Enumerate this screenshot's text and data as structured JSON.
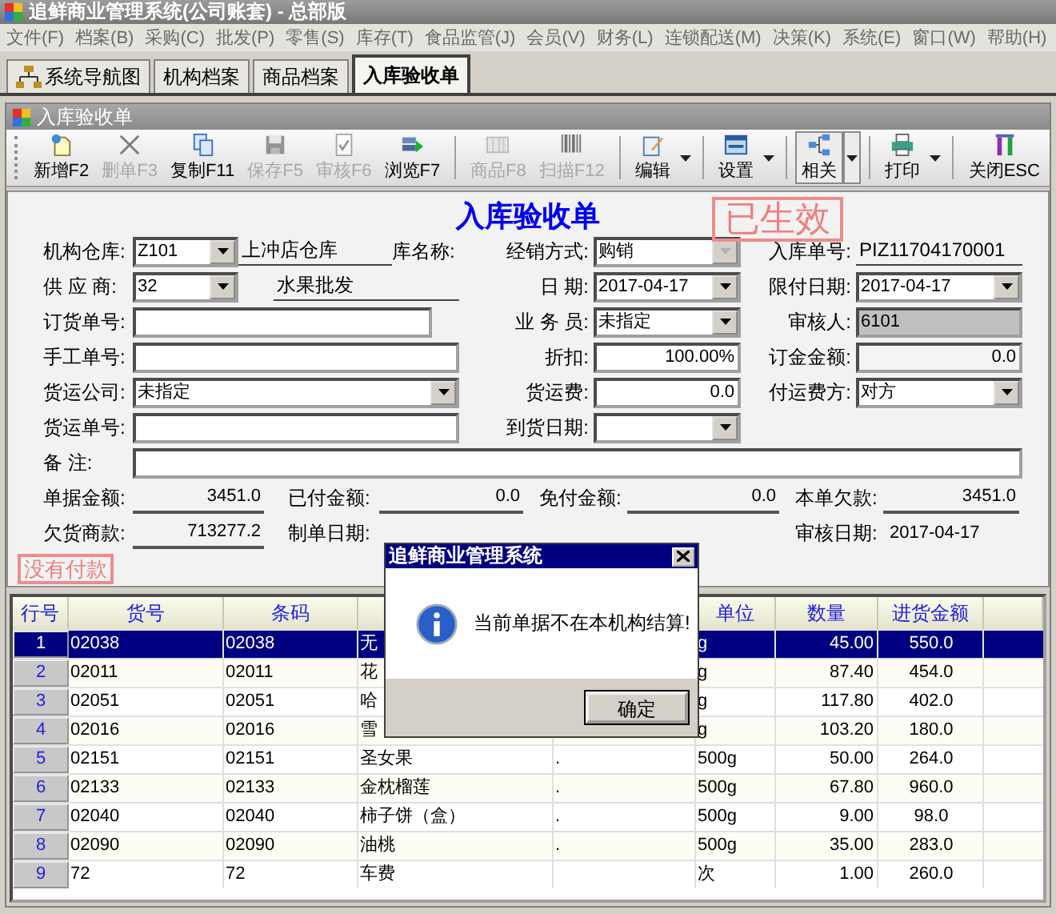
{
  "window": {
    "title": "追鲜商业管理系统(公司账套) - 总部版"
  },
  "menu": [
    "文件(F)",
    "档案(B)",
    "采购(C)",
    "批发(P)",
    "零售(S)",
    "库存(T)",
    "食品监管(J)",
    "会员(V)",
    "财务(L)",
    "连锁配送(M)",
    "决策(K)",
    "系统(E)",
    "窗口(W)",
    "帮助(H)"
  ],
  "tabs": [
    {
      "label": "系统导航图",
      "selected": false
    },
    {
      "label": "机构档案",
      "selected": false
    },
    {
      "label": "商品档案",
      "selected": false
    },
    {
      "label": "入库验收单",
      "selected": true
    }
  ],
  "document": {
    "title": "入库验收单",
    "toolbar": [
      {
        "label": "新增F2",
        "kind": "plain",
        "disabled": false,
        "pressed": false
      },
      {
        "label": "删单F3",
        "kind": "plain",
        "disabled": true,
        "pressed": false
      },
      {
        "label": "复制F11",
        "kind": "plain",
        "disabled": false,
        "pressed": false
      },
      {
        "label": "保存F5",
        "kind": "plain",
        "disabled": true,
        "pressed": false
      },
      {
        "label": "审核F6",
        "kind": "plain",
        "disabled": true,
        "pressed": false
      },
      {
        "label": "浏览F7",
        "kind": "plain",
        "disabled": false,
        "pressed": false
      },
      {
        "label": "商品F8",
        "kind": "plain",
        "disabled": true,
        "pressed": false
      },
      {
        "label": "扫描F12",
        "kind": "plain",
        "disabled": true,
        "pressed": false
      },
      {
        "label": "编辑",
        "kind": "dropdown",
        "disabled": false,
        "pressed": false
      },
      {
        "label": "设置",
        "kind": "dropdown",
        "disabled": false,
        "pressed": false
      },
      {
        "label": "相关",
        "kind": "dropdown",
        "disabled": false,
        "pressed": true
      },
      {
        "label": "打印",
        "kind": "dropdown",
        "disabled": false,
        "pressed": false
      },
      {
        "label": "关闭ESC",
        "kind": "plain",
        "disabled": false,
        "pressed": false
      }
    ],
    "form": {
      "title": "入库验收单",
      "fields": [
        {
          "label": "机构仓库:",
          "kind": "combo",
          "value": "Z101",
          "disabled": false,
          "name": "上冲店仓库"
        },
        {
          "label": "库名称:",
          "kind": "label"
        },
        {
          "label": "经销方式:",
          "kind": "combo",
          "value": "购销",
          "disabled": true
        },
        {
          "label": "入库单号:",
          "kind": "display",
          "value": "PIZ11704170001"
        },
        {
          "label": "供 应 商:",
          "kind": "combo",
          "value": "32",
          "disabled": false,
          "name": "水果批发"
        },
        {
          "label": "日    期:",
          "kind": "combo",
          "value": "2017-04-17",
          "disabled": false
        },
        {
          "label": "限付日期:",
          "kind": "combo",
          "value": "2017-04-17",
          "disabled": false
        },
        {
          "label": "订货单号:",
          "kind": "input"
        },
        {
          "label": "业 务 员:",
          "kind": "combo",
          "value": "未指定",
          "disabled": false
        },
        {
          "label": "审核人:",
          "kind": "readonly",
          "value": "6101"
        },
        {
          "label": "手工单号:",
          "kind": "input"
        },
        {
          "label": "折扣:",
          "kind": "number",
          "value": "100.00%"
        },
        {
          "label": "订金金额:",
          "kind": "static",
          "value": "0.0"
        },
        {
          "label": "货运公司:",
          "kind": "combo",
          "value": "未指定",
          "disabled": false
        },
        {
          "label": "货运费:",
          "kind": "number",
          "value": "0.0"
        },
        {
          "label": "付运费方:",
          "kind": "combo",
          "value": "对方",
          "disabled": false
        },
        {
          "label": "货运单号:",
          "kind": "input"
        },
        {
          "label": "到货日期:",
          "kind": "combo",
          "disabled": false
        },
        {
          "label": "备    注:",
          "kind": "input"
        }
      ],
      "totals": [
        {
          "label": "单据金额:",
          "kind": "amount",
          "value": "3451.0"
        },
        {
          "label": "已付金额:",
          "kind": "amount",
          "value": "0.0"
        },
        {
          "label": "免付金额:",
          "kind": "amount",
          "value": "0.0"
        },
        {
          "label": "本单欠款:",
          "kind": "amount",
          "value": "3451.0"
        },
        {
          "label": "欠货商款:",
          "kind": "amount",
          "value": "713277.2"
        },
        {
          "label": "制单日期:",
          "kind": "label"
        },
        {
          "label": "审核日期:",
          "kind": "plain",
          "value": "2017-04-17"
        }
      ]
    },
    "stamps": [
      {
        "kind": "status",
        "text": "已生效"
      },
      {
        "kind": "payment",
        "text": "没有付款"
      }
    ],
    "grid": {
      "columns": [
        "行号",
        "货号",
        "条码",
        null,
        null,
        "单位",
        "数量",
        "进货金额",
        null
      ],
      "rows": [
        {
          "no": "1",
          "selected": true,
          "cells": [
            "02038",
            "02038",
            "无",
            null,
            "g",
            "45.00",
            "550.0"
          ]
        },
        {
          "no": "2",
          "selected": false,
          "cells": [
            "02011",
            "02011",
            "花",
            null,
            "g",
            "87.40",
            "454.0"
          ]
        },
        {
          "no": "3",
          "selected": false,
          "cells": [
            "02051",
            "02051",
            "哈",
            null,
            "g",
            "117.80",
            "402.0"
          ]
        },
        {
          "no": "4",
          "selected": false,
          "cells": [
            "02016",
            "02016",
            "雪",
            null,
            "g",
            "103.20",
            "180.0"
          ]
        },
        {
          "no": "5",
          "selected": false,
          "cells": [
            "02151",
            "02151",
            "圣女果",
            ".",
            "500g",
            "50.00",
            "264.0"
          ]
        },
        {
          "no": "6",
          "selected": false,
          "cells": [
            "02133",
            "02133",
            "金枕榴莲",
            ".",
            "500g",
            "67.80",
            "960.0"
          ]
        },
        {
          "no": "7",
          "selected": false,
          "cells": [
            "02040",
            "02040",
            "柿子饼（盒）",
            ".",
            "500g",
            "9.00",
            "98.0"
          ]
        },
        {
          "no": "8",
          "selected": false,
          "cells": [
            "02090",
            "02090",
            "油桃",
            ".",
            "500g",
            "35.00",
            "283.0"
          ]
        },
        {
          "no": "9",
          "selected": false,
          "cells": [
            "72",
            "72",
            "车费",
            null,
            "次",
            "1.00",
            "260.0"
          ]
        }
      ]
    }
  },
  "dialog": {
    "title": "追鲜商业管理系统",
    "message": "当前单据不在本机构结算!",
    "buttons": [
      "确定"
    ]
  }
}
